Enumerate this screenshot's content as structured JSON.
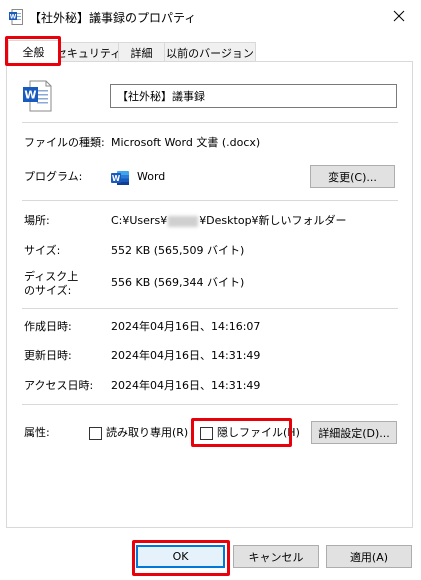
{
  "window": {
    "title": "【社外秘】議事録のプロパティ",
    "app_icon": "word-doc-icon",
    "close_icon": "close-icon"
  },
  "tabs": [
    {
      "label": "全般",
      "active": true
    },
    {
      "label": "セキュリティ",
      "active": false
    },
    {
      "label": "詳細",
      "active": false
    },
    {
      "label": "以前のバージョン",
      "active": false
    }
  ],
  "general": {
    "file_name": "【社外秘】議事録",
    "file_type_label": "ファイルの種類:",
    "file_type_value": "Microsoft Word 文書 (.docx)",
    "program_label": "プログラム:",
    "program_value": "Word",
    "change_button": "変更(C)...",
    "location_label": "場所:",
    "location_prefix": "C:¥Users¥",
    "location_suffix": "¥Desktop¥新しいフォルダー",
    "size_label": "サイズ:",
    "size_value": "552 KB (565,509 バイト)",
    "disk_size_label_1": "ディスク上",
    "disk_size_label_2": "のサイズ:",
    "disk_size_value": "556 KB (569,344 バイト)",
    "created_label": "作成日時:",
    "created_value": "2024年04月16日、14:16:07",
    "modified_label": "更新日時:",
    "modified_value": "2024年04月16日、14:31:49",
    "accessed_label": "アクセス日時:",
    "accessed_value": "2024年04月16日、14:31:49",
    "attributes_label": "属性:",
    "readonly_label": "読み取り専用(R)",
    "readonly_checked": false,
    "hidden_label": "隠しファイル(H)",
    "hidden_checked": false,
    "advanced_button": "詳細設定(D)..."
  },
  "footer": {
    "ok": "OK",
    "cancel": "キャンセル",
    "apply": "適用(A)"
  },
  "colors": {
    "highlight": "#e8000b",
    "word_blue": "#185abd",
    "accent": "#0078d7"
  }
}
